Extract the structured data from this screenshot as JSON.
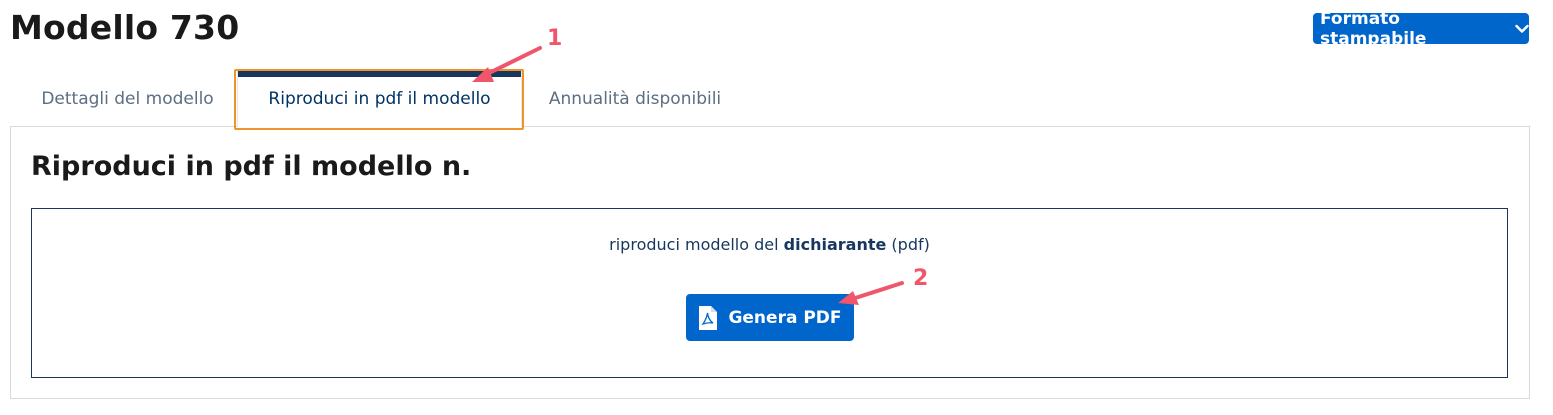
{
  "page": {
    "title": "Modello 730"
  },
  "header": {
    "print_button_label": "Formato stampabile",
    "print_button_icon": "chevron-down-icon"
  },
  "tabs": [
    {
      "label": "Dettagli del modello",
      "active": false
    },
    {
      "label": "Riproduci in pdf il modello",
      "active": true
    },
    {
      "label": "Annualità disponibili",
      "active": false
    }
  ],
  "panel": {
    "title": "Riproduci in pdf il modello n.",
    "description": {
      "prefix": "riproduci modello del ",
      "emphasis": "dichiarante",
      "suffix": " (pdf)"
    },
    "generate_button_label": "Genera PDF",
    "generate_button_icon": "pdf-file-icon"
  },
  "annotations": [
    {
      "label": "1",
      "target": "tab-riproduci-pdf"
    },
    {
      "label": "2",
      "target": "genera-pdf-button"
    }
  ],
  "colors": {
    "accent": "#0066cc",
    "navy": "#17375e",
    "highlight": "#f0932b",
    "annotation": "#f0566b",
    "inactive_tab": "#5c6f82"
  }
}
